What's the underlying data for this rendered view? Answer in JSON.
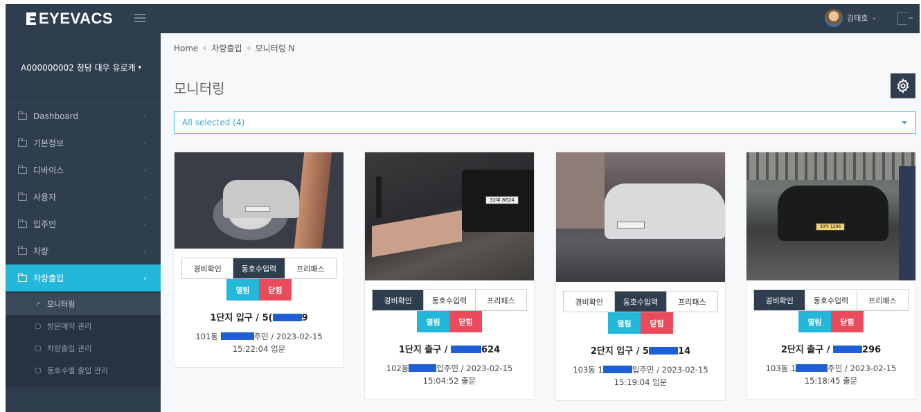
{
  "brand": {
    "name": "EYEVACS"
  },
  "user": {
    "name": "김태호"
  },
  "sidebar": {
    "site": "A000000002 청담 대우 유로캐",
    "items": [
      {
        "label": "Dashboard"
      },
      {
        "label": "기본정보"
      },
      {
        "label": "디바이스"
      },
      {
        "label": "사용자"
      },
      {
        "label": "입주민"
      },
      {
        "label": "차량"
      },
      {
        "label": "차량출입"
      }
    ],
    "sub_items": [
      {
        "label": "모니터링"
      },
      {
        "label": "방문예약 관리"
      },
      {
        "label": "차량출입 관리"
      },
      {
        "label": "동호수별 출입 관리"
      }
    ]
  },
  "breadcrumb": [
    "Home",
    "차량출입",
    "모니터링 N"
  ],
  "page": {
    "title": "모니터링"
  },
  "filter": {
    "value": "All selected (4)"
  },
  "cards": [
    {
      "tabs": [
        "경비확인",
        "동호수입력",
        "프리패스"
      ],
      "active_tab": 1,
      "open_label": "열림",
      "close_label": "닫힘",
      "title_a": "1단지 입구 / 5(",
      "title_b": "9",
      "info_a": "101동 ",
      "info_b": "주민 / 2023-02-15",
      "info_c": "15:22:04 입문"
    },
    {
      "tabs": [
        "경비확인",
        "동호수입력",
        "프리패스"
      ],
      "active_tab": 0,
      "open_label": "열림",
      "close_label": "닫힘",
      "title_a": "1단지 출구 / ",
      "title_b": "624",
      "info_a": "102동",
      "info_b": "입주민 / 2023-02-15",
      "info_c": "15:04:52 출문"
    },
    {
      "tabs": [
        "경비확인",
        "동호수입력",
        "프리패스"
      ],
      "active_tab": 1,
      "open_label": "열림",
      "close_label": "닫힘",
      "title_a": "2단지 입구 / 5",
      "title_b": "14",
      "info_a": "103동 1",
      "info_b": "입주민 / 2023-02-15",
      "info_c": "15:19:04 입문"
    },
    {
      "tabs": [
        "경비확인",
        "동호수입력",
        "프리패스"
      ],
      "active_tab": 0,
      "open_label": "열림",
      "close_label": "닫힘",
      "title_a": "2단지 출구 / ",
      "title_b": "296",
      "info_a": "103동 1",
      "info_b": "주민 / 2023-02-15",
      "info_c": "15:18:45 출문"
    }
  ],
  "plates": [
    "",
    "32부 8624",
    "",
    "30부 1296"
  ],
  "colors": {
    "accent": "#23b7d9",
    "danger": "#e94b5b",
    "sidebar": "#2f3e4e"
  }
}
